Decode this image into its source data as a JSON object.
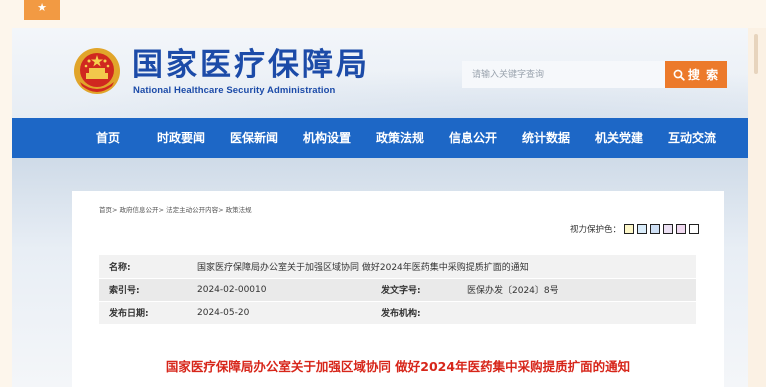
{
  "site": {
    "title": "国家医疗保障局",
    "subtitle": "National Healthcare Security Administration"
  },
  "search": {
    "placeholder": "请输入关键字查询",
    "button_label": "搜 索"
  },
  "nav": {
    "items": [
      {
        "label": "首页"
      },
      {
        "label": "时政要闻"
      },
      {
        "label": "医保新闻"
      },
      {
        "label": "机构设置"
      },
      {
        "label": "政策法规"
      },
      {
        "label": "信息公开"
      },
      {
        "label": "统计数据"
      },
      {
        "label": "机关党建"
      },
      {
        "label": "互动交流"
      }
    ]
  },
  "breadcrumb": {
    "items": [
      "首页",
      "政府信息公开",
      "法定主动公开内容",
      "政策法规"
    ],
    "separator": ">"
  },
  "color_protect": {
    "label": "视力保护色：",
    "swatches": [
      "#fdf7c9",
      "#d9ecfa",
      "#cfe0f5",
      "#ebe0f3",
      "#efd8ef",
      "#ffffff"
    ]
  },
  "meta": {
    "name_label": "名称:",
    "name_value": "国家医疗保障局办公室关于加强区域协同 做好2024年医药集中采购提质扩面的通知",
    "index_label": "索引号:",
    "index_value": "2024-02-00010",
    "doc_no_label": "发文字号:",
    "doc_no_value": "医保办发〔2024〕8号",
    "date_label": "发布日期:",
    "date_value": "2024-05-20",
    "org_label": "发布机构:",
    "org_value": ""
  },
  "article": {
    "title": "国家医疗保障局办公室关于加强区域协同 做好2024年医药集中采购提质扩面的通知"
  },
  "colors": {
    "nav_bg": "#1d67c6",
    "brand_blue": "#1c4ba8",
    "search_orange": "#ec7a2b",
    "title_red": "#d7261a"
  }
}
